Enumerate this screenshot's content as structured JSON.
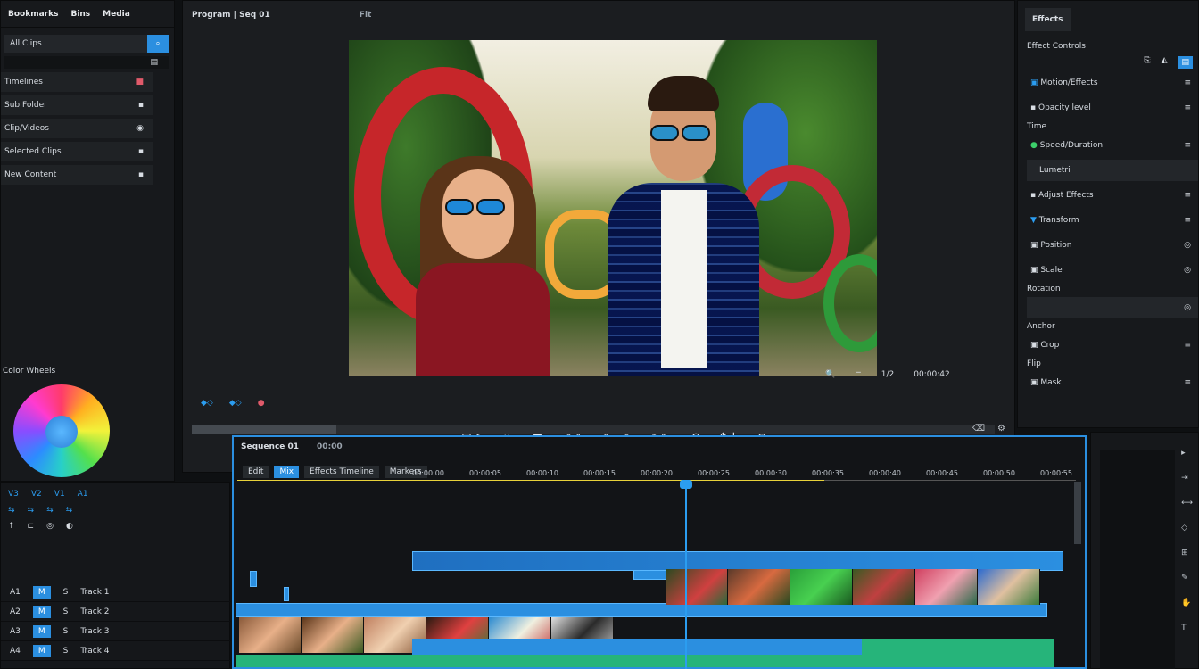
{
  "left": {
    "tabs": [
      "Bookmarks",
      "Bins",
      "Media"
    ],
    "search_label": "All Clips",
    "items": [
      {
        "label": "Timelines",
        "badge": "■"
      },
      {
        "label": "Sub Folder",
        "badge": "▪"
      },
      {
        "label": "Clip/Videos",
        "badge": "◉"
      },
      {
        "label": "Selected Clips",
        "badge": "▪"
      },
      {
        "label": "New Content",
        "badge": "▪"
      }
    ],
    "color_label": "Color Wheels"
  },
  "monitor": {
    "title": "Program | Seq 01",
    "zoom": "Fit",
    "timecode": "00:00:42",
    "scrub_icons": [
      "◆◇",
      "◆◇",
      "●"
    ],
    "controls": [
      "⊡ >",
      "⇤",
      "⊏",
      "◁◁",
      "◁",
      "▷",
      "▷▷",
      "⟲",
      "↑↓",
      "⊕"
    ],
    "bar_icons": [
      "🔍",
      "⊏",
      "1/2",
      "⊞"
    ]
  },
  "right": {
    "tab": "Effects",
    "header": "Effect Controls",
    "rows": [
      {
        "label": "Motion/Effects",
        "icon": "▣",
        "kind": "blue"
      },
      {
        "label": "Opacity level",
        "icon": "▪",
        "kind": "plain"
      },
      {
        "label": "Time",
        "icon": "",
        "kind": "header"
      },
      {
        "label": "Speed/Duration",
        "icon": "●",
        "kind": "green"
      },
      {
        "label": "Lumetri",
        "icon": "",
        "kind": "box"
      },
      {
        "label": "Adjust Effects",
        "icon": "▪",
        "kind": "plain"
      },
      {
        "label": "Transform",
        "icon": "▼",
        "kind": "blue"
      },
      {
        "label": "Position",
        "icon": "▣",
        "kind": "plain"
      },
      {
        "label": "Scale",
        "icon": "▣",
        "kind": "plain"
      },
      {
        "label": "Rotation",
        "icon": "",
        "kind": "header"
      },
      {
        "label": "Anchor",
        "icon": "",
        "kind": "header"
      },
      {
        "label": "Crop",
        "icon": "▣",
        "kind": "plain"
      },
      {
        "label": "Flip",
        "icon": "",
        "kind": "header"
      },
      {
        "label": "Mask",
        "icon": "▣",
        "kind": "plain"
      }
    ]
  },
  "tracks": {
    "icon_rows": [
      [
        "V3",
        "V2",
        "V1",
        "A1"
      ],
      [
        "⇆",
        "⇆",
        "⇆",
        "⇆"
      ],
      [
        "↑",
        "⊏",
        "◎",
        "◐"
      ]
    ],
    "headers": [
      {
        "a": "A1",
        "b": "M",
        "c": "S",
        "d": "Track 1"
      },
      {
        "a": "A2",
        "b": "M",
        "c": "S",
        "d": "Track 2"
      },
      {
        "a": "A3",
        "b": "M",
        "c": "S",
        "d": "Track 3"
      },
      {
        "a": "A4",
        "b": "M",
        "c": "S",
        "d": "Track 4"
      }
    ]
  },
  "timeline": {
    "title": "Sequence 01",
    "timecode": "00:00",
    "subtabs": [
      "Edit",
      "Mix",
      "Effects Timeline",
      "Markers"
    ],
    "ruler": [
      "00:00:00",
      "00:00:05",
      "00:00:10",
      "00:00:15",
      "00:00:20",
      "00:00:25",
      "00:00:30",
      "00:00:35",
      "00:00:40",
      "00:00:45",
      "00:00:50",
      "00:00:55"
    ]
  },
  "colors": {
    "accent": "#2b8fe0",
    "audio": "#26b47a",
    "playhead": "#2b9df0",
    "ruler_work_area": "#e8d23a"
  }
}
